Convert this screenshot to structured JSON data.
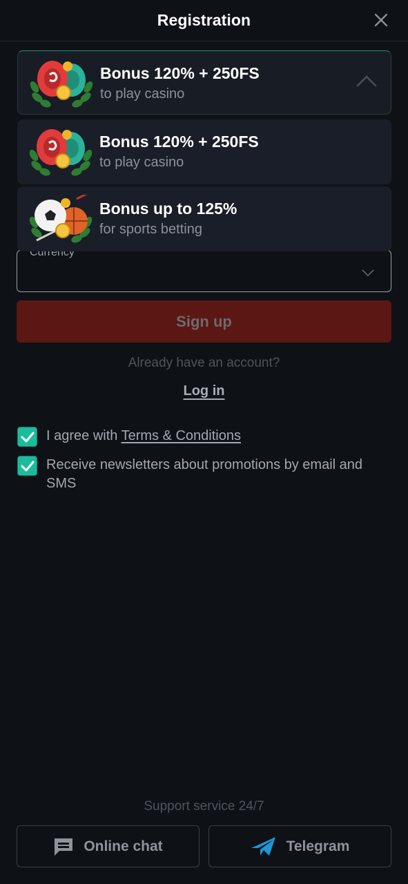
{
  "header": {
    "title": "Registration",
    "close_icon": "close-icon"
  },
  "bonus_select": {
    "selected": {
      "title": "Bonus 120% + 250FS",
      "subtitle": "to play casino",
      "icon": "casino-chips-icon"
    },
    "expanded": true,
    "options": [
      {
        "title": "Bonus 120% + 250FS",
        "subtitle": "to play casino",
        "icon": "casino-chips-icon"
      },
      {
        "title": "Bonus up to 125%",
        "subtitle": "for sports betting",
        "icon": "sports-balls-icon"
      }
    ]
  },
  "form": {
    "currency_label": "Currency",
    "currency_value": "",
    "signup_label": "Sign up",
    "already_text": "Already have an account?",
    "login_label": "Log in"
  },
  "checkboxes": [
    {
      "prefix": "I agree with ",
      "link": "Terms & Conditions",
      "checked": true
    },
    {
      "prefix": "Receive newsletters about promotions by email and SMS",
      "link": "",
      "checked": true
    }
  ],
  "support": {
    "title": "Support service 24/7",
    "chat_label": "Online chat",
    "telegram_label": "Telegram"
  },
  "colors": {
    "background": "#0e1116",
    "accent": "#1bbc9b",
    "signup_bg": "#5a1714",
    "telegram": "#1e96d6"
  }
}
